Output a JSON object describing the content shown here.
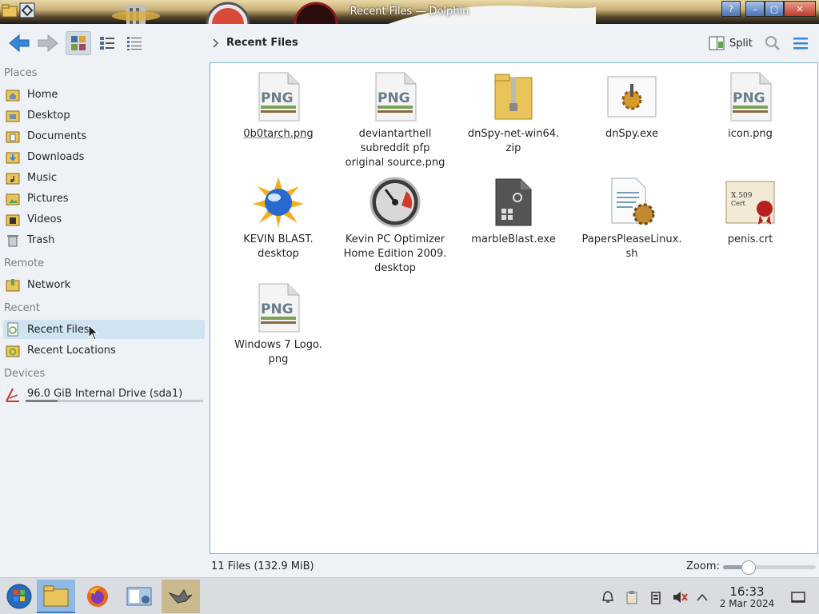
{
  "window": {
    "title": "Recent Files — Dolphin",
    "buttons": {
      "help": "?",
      "minimize": "–",
      "maximize": "▢",
      "close": "✕"
    }
  },
  "toolbar": {
    "split_label": "Split",
    "breadcrumb": "Recent Files"
  },
  "sidebar": {
    "sections": {
      "places": "Places",
      "remote": "Remote",
      "recent": "Recent",
      "devices": "Devices"
    },
    "places": [
      {
        "label": "Home",
        "icon": "home-folder-icon"
      },
      {
        "label": "Desktop",
        "icon": "desktop-folder-icon"
      },
      {
        "label": "Documents",
        "icon": "documents-folder-icon"
      },
      {
        "label": "Downloads",
        "icon": "downloads-folder-icon"
      },
      {
        "label": "Music",
        "icon": "music-folder-icon"
      },
      {
        "label": "Pictures",
        "icon": "pictures-folder-icon"
      },
      {
        "label": "Videos",
        "icon": "videos-folder-icon"
      },
      {
        "label": "Trash",
        "icon": "trash-icon"
      }
    ],
    "remote": [
      {
        "label": "Network",
        "icon": "network-folder-icon"
      }
    ],
    "recent": [
      {
        "label": "Recent Files",
        "icon": "recent-files-icon"
      },
      {
        "label": "Recent Locations",
        "icon": "recent-locations-icon"
      }
    ],
    "devices": [
      {
        "label": "96.0 GiB Internal Drive (sda1)",
        "icon": "drive-icon",
        "usage": 0.18
      }
    ]
  },
  "files": [
    {
      "name": "0b0tarch.png",
      "icon": "png-file-icon"
    },
    {
      "name": "deviantarthell\nsubreddit pfp\noriginal source.png",
      "icon": "png-file-icon"
    },
    {
      "name": "dnSpy-net-win64.\nzip",
      "icon": "zip-folder-icon"
    },
    {
      "name": "dnSpy.exe",
      "icon": "exe-gear-icon"
    },
    {
      "name": "icon.png",
      "icon": "png-file-icon"
    },
    {
      "name": "KEVIN BLAST.\ndesktop",
      "icon": "blast-orb-icon"
    },
    {
      "name": "Kevin PC Optimizer\nHome Edition 2009.\ndesktop",
      "icon": "gauge-icon"
    },
    {
      "name": "marbleBlast.exe",
      "icon": "executable-file-icon"
    },
    {
      "name": "PapersPleaseLinux.\nsh",
      "icon": "script-file-icon"
    },
    {
      "name": "penis.crt",
      "icon": "certificate-icon"
    },
    {
      "name": "Windows 7 Logo.\npng",
      "icon": "png-file-icon"
    }
  ],
  "status": {
    "summary": "11 Files (132.9 MiB)",
    "zoom_label": "Zoom:",
    "zoom_level": 0.28
  },
  "taskbar": {
    "clock_time": "16:33",
    "clock_date": "2 Mar 2024"
  },
  "colors": {
    "accent": "#3daee9",
    "selection": "#cfe3f1",
    "folder": "#e8c45a"
  }
}
